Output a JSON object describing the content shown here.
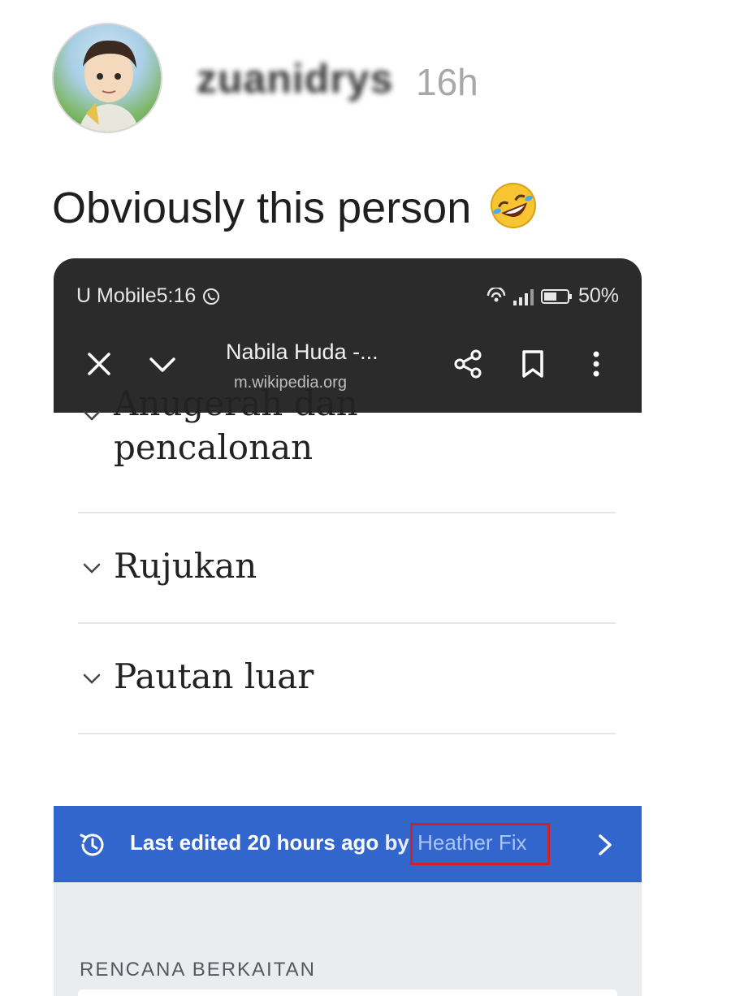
{
  "post": {
    "username": "zuanidrys",
    "time": "16h",
    "caption": "Obviously this person",
    "caption_emoji": "rolling-on-floor-laughing"
  },
  "screenshot": {
    "status_bar": {
      "carrier": "U Mobile",
      "clock": "5:16",
      "battery": "50%"
    },
    "browser": {
      "page_title": "Nabila Huda -...",
      "domain": "m.wikipedia.org"
    },
    "toc": [
      {
        "label_line1": "Anugerah dan",
        "label_line2": "pencalonan"
      },
      {
        "label": "Rujukan"
      },
      {
        "label": "Pautan luar"
      }
    ],
    "banner": {
      "prefix": "Last edited 20 hours ago",
      "by": " by ",
      "editor": "Heather Fix"
    },
    "related_heading": "RENCANA BERKAITAN"
  },
  "colors": {
    "browser_bar": "#2b2b2b",
    "banner": "#3366cc",
    "highlight_box": "#d21f2a"
  }
}
